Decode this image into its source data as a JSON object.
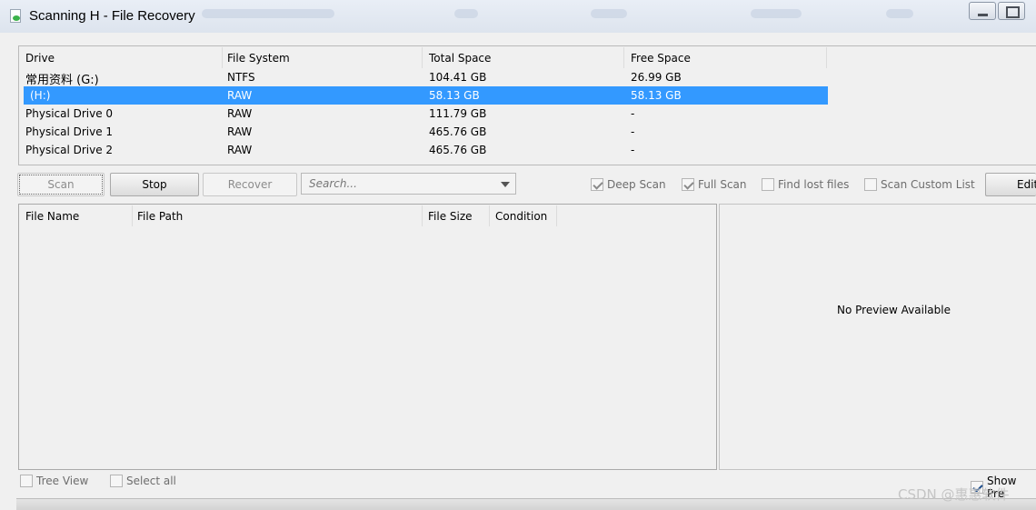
{
  "window": {
    "title": "Scanning H - File Recovery"
  },
  "drives": {
    "columns": [
      "Drive",
      "File System",
      "Total Space",
      "Free Space"
    ],
    "rows": [
      {
        "drive": "常用资料 (G:)",
        "fs": "NTFS",
        "total": "104.41 GB",
        "free": "26.99 GB"
      },
      {
        "drive": "(H:)",
        "fs": "RAW",
        "total": "58.13 GB",
        "free": "58.13 GB"
      },
      {
        "drive": "Physical Drive 0",
        "fs": "RAW",
        "total": "111.79 GB",
        "free": "-"
      },
      {
        "drive": "Physical Drive 1",
        "fs": "RAW",
        "total": "465.76 GB",
        "free": "-"
      },
      {
        "drive": "Physical Drive 2",
        "fs": "RAW",
        "total": "465.76 GB",
        "free": "-"
      }
    ],
    "selected_row": 1
  },
  "toolbar": {
    "scan": "Scan",
    "stop": "Stop",
    "recover": "Recover",
    "search_placeholder": "Search...",
    "deep_scan": "Deep Scan",
    "full_scan": "Full Scan",
    "find_lost_files": "Find lost files",
    "scan_custom_list": "Scan Custom List",
    "edit": "Edit"
  },
  "files": {
    "columns": [
      "File Name",
      "File Path",
      "File Size",
      "Condition"
    ]
  },
  "preview": {
    "message": "No Preview Available",
    "show_preview": "Show Pre"
  },
  "footer": {
    "tree_view": "Tree View",
    "select_all": "Select all"
  },
  "watermark": "CSDN @惠惠软件",
  "colors": {
    "selection": "#3399ff",
    "window_bg": "#f0f0f0",
    "titlebar": "#e9eef6"
  }
}
